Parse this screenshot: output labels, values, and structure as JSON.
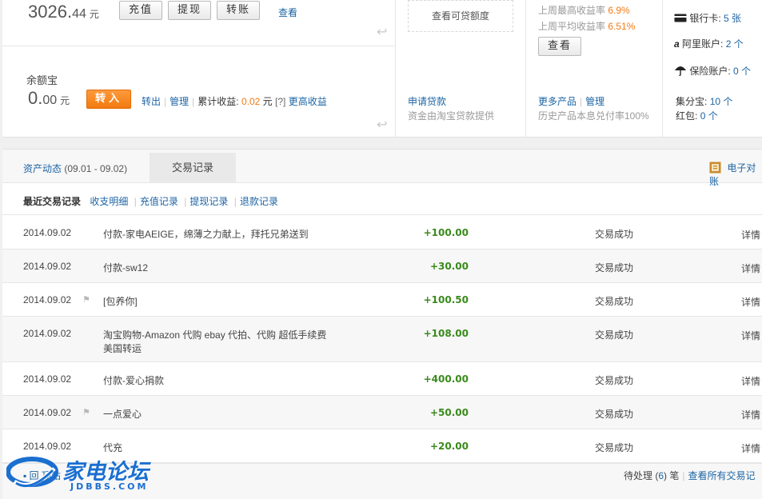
{
  "balance": {
    "int": "3026.",
    "dec": "44",
    "unit": "元",
    "btn_recharge": "充值",
    "btn_withdraw": "提现",
    "btn_transfer": "转账",
    "view": "查看"
  },
  "yuebao": {
    "label": "余额宝",
    "int": "0.",
    "dec": "00",
    "unit": "元",
    "btn_in": "转入",
    "out": "转出",
    "manage": "管理",
    "cum_label": "累计收益:",
    "cum_value": "0.02",
    "cum_unit": "元",
    "help": "[?]",
    "more_earnings": "更高收益"
  },
  "loan": {
    "credit_btn": "查看可贷额度",
    "apply": "申请贷款",
    "desc": "资金由淘宝贷款提供"
  },
  "products": {
    "max_label": "上周最高收益率",
    "max_value": "6.9%",
    "avg_label": "上周平均收益率",
    "avg_value": "6.51%",
    "view_btn": "查看",
    "more": "更多产品",
    "manage": "管理",
    "history": "历史产品本息兑付率100%"
  },
  "accounts": {
    "bank_label": "银行卡:",
    "bank_value": "5 张",
    "ali_label": "阿里账户:",
    "ali_value": "2 个",
    "ins_label": "保险账户:",
    "ins_value": "0 个",
    "points_label": "集分宝:",
    "points_value": "10 个",
    "redpack_label": "红包:",
    "redpack_value": "0 个"
  },
  "tabs": {
    "asset_activity": "资产动态",
    "asset_range": "(09.01 - 09.02)",
    "transactions": "交易记录",
    "e_statement": "电子对账"
  },
  "filters": {
    "recent": "最近交易记录",
    "income_detail": "收支明细",
    "recharge_records": "充值记录",
    "withdraw_records": "提现记录",
    "refund_records": "退款记录"
  },
  "rows": [
    {
      "date": "2014.09.02",
      "desc1": "付款-家电AEIGE，绵薄之力献上，拜托兄弟送到",
      "desc2": "",
      "amount": "+100.00",
      "status": "交易成功",
      "detail": "详情",
      "flag": false
    },
    {
      "date": "2014.09.02",
      "desc1": "付款-sw12",
      "desc2": "",
      "amount": "+30.00",
      "status": "交易成功",
      "detail": "详情",
      "flag": false
    },
    {
      "date": "2014.09.02",
      "desc1": "[包养你]",
      "desc2": "",
      "amount": "+100.50",
      "status": "交易成功",
      "detail": "详情",
      "flag": true
    },
    {
      "date": "2014.09.02",
      "desc1": "淘宝购物-Amazon 代购 ebay 代拍、代购 超低手续费",
      "desc2": "美国转运",
      "amount": "+108.00",
      "status": "交易成功",
      "detail": "详情",
      "flag": false
    },
    {
      "date": "2014.09.02",
      "desc1": "付款-爱心捐款",
      "desc2": "",
      "amount": "+400.00",
      "status": "交易成功",
      "detail": "详情",
      "flag": false
    },
    {
      "date": "2014.09.02",
      "desc1": "一点爱心",
      "desc2": "",
      "amount": "+50.00",
      "status": "交易成功",
      "detail": "详情",
      "flag": true
    },
    {
      "date": "2014.09.02",
      "desc1": "代充",
      "desc2": "",
      "amount": "+20.00",
      "status": "交易成功",
      "detail": "详情",
      "flag": false
    }
  ],
  "footer": {
    "back": "回",
    "back2": "顶站",
    "pending_label": "待处理 (",
    "pending_count": "6",
    "pending_suffix": ") 笔",
    "view_all": "查看所有交易记"
  },
  "watermark": {
    "name": "家电论坛",
    "domain": "JDBBS.COM"
  },
  "colors": {
    "link": "#1c64a4",
    "accent_orange": "#f07b14",
    "amount_green": "#3a8a1c"
  }
}
